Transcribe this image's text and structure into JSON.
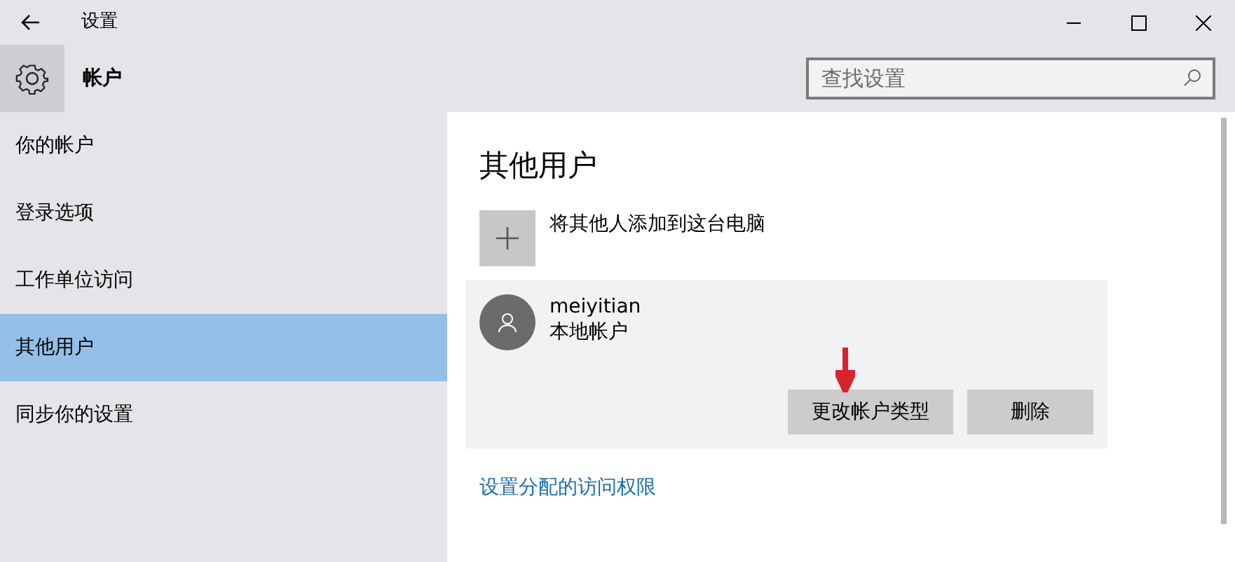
{
  "window": {
    "title": "设置"
  },
  "header": {
    "title": "帐户",
    "search": {
      "placeholder": "查找设置"
    }
  },
  "sidebar": {
    "items": [
      {
        "label": "你的帐户",
        "selected": false
      },
      {
        "label": "登录选项",
        "selected": false
      },
      {
        "label": "工作单位访问",
        "selected": false
      },
      {
        "label": "其他用户",
        "selected": true
      },
      {
        "label": "同步你的设置",
        "selected": false
      }
    ]
  },
  "content": {
    "heading": "其他用户",
    "add_user": {
      "label": "将其他人添加到这台电脑"
    },
    "user": {
      "name": "meiyitian",
      "type": "本地帐户",
      "buttons": [
        "更改帐户类型",
        "删除"
      ]
    },
    "link": "设置分配的访问权限"
  }
}
